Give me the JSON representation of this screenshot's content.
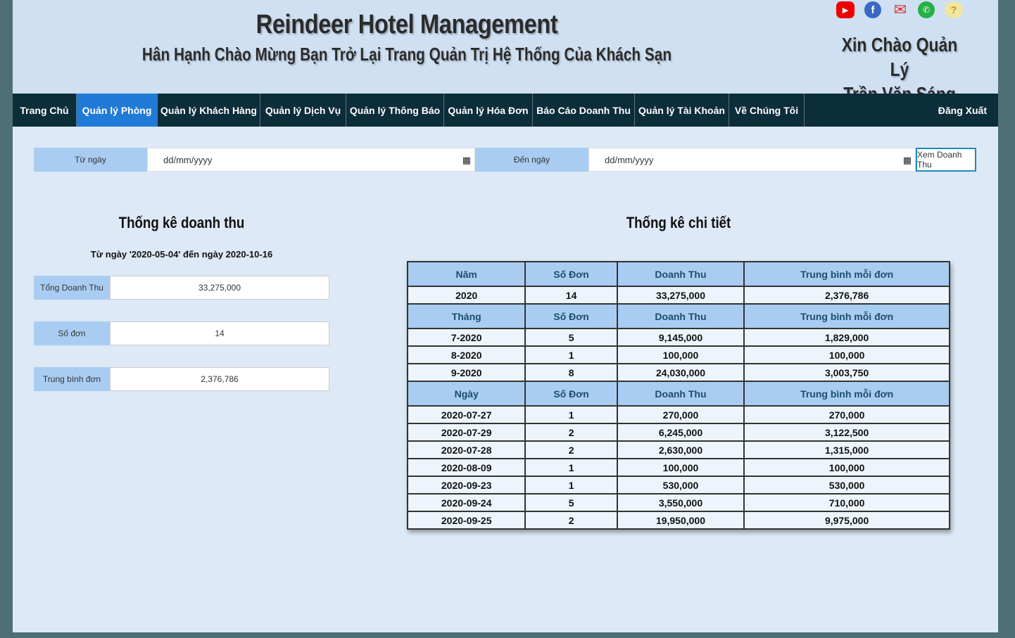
{
  "header": {
    "title": "Reindeer Hotel Management",
    "subtitle": "Hân Hạnh Chào Mừng Bạn Trở Lại Trang Quản Trị Hệ Thống Của Khách Sạn",
    "greeting_line1": "Xin Chào Quản Lý",
    "greeting_line2": "Trần Văn Sáng",
    "social_icons": [
      "youtube-icon",
      "facebook-icon",
      "gmail-icon",
      "whatsapp-icon",
      "help-icon"
    ]
  },
  "nav": {
    "items": [
      {
        "label": "Trang Chủ"
      },
      {
        "label": "Quản lý Phòng",
        "active": true
      },
      {
        "label": "Quản lý Khách Hàng"
      },
      {
        "label": "Quản lý Dịch Vụ"
      },
      {
        "label": "Quản lý Thông Báo"
      },
      {
        "label": "Quản lý Hóa Đơn"
      },
      {
        "label": "Báo Cáo Doanh Thu"
      },
      {
        "label": "Quản lý Tài Khoản"
      },
      {
        "label": "Về Chúng Tôi"
      }
    ],
    "logout": "Đăng Xuất",
    "active_color": "#1f7bd6",
    "bar_color": "#0c2d3a"
  },
  "filter": {
    "from_label": "Từ ngày",
    "from_placeholder": "dd/mm/yyyy",
    "to_label": "Đến ngày",
    "to_placeholder": "dd/mm/yyyy",
    "submit": "Xem Doanh Thu"
  },
  "summary": {
    "title": "Thống kê doanh thu",
    "range": "Từ ngày '2020-05-04' đến ngày 2020-10-16",
    "total_label": "Tổng Doanh Thu",
    "total_value": "33,275,000",
    "orders_label": "Số đơn",
    "orders_value": "14",
    "avg_label": "Trung bình đơn",
    "avg_value": "2,376,786"
  },
  "detail": {
    "title": "Thống kê chi tiết",
    "year_header": [
      "Năm",
      "Số Đơn",
      "Doanh Thu",
      "Trung bình mỗi đơn"
    ],
    "year_rows": [
      [
        "2020",
        "14",
        "33,275,000",
        "2,376,786"
      ]
    ],
    "month_header": [
      "Tháng",
      "Số Đơn",
      "Doanh Thu",
      "Trung bình mỗi đơn"
    ],
    "month_rows": [
      [
        "7-2020",
        "5",
        "9,145,000",
        "1,829,000"
      ],
      [
        "8-2020",
        "1",
        "100,000",
        "100,000"
      ],
      [
        "9-2020",
        "8",
        "24,030,000",
        "3,003,750"
      ]
    ],
    "day_header": [
      "Ngày",
      "Số Đơn",
      "Doanh Thu",
      "Trung bình mỗi đơn"
    ],
    "day_rows": [
      [
        "2020-07-27",
        "1",
        "270,000",
        "270,000"
      ],
      [
        "2020-07-29",
        "2",
        "6,245,000",
        "3,122,500"
      ],
      [
        "2020-07-28",
        "2",
        "2,630,000",
        "1,315,000"
      ],
      [
        "2020-08-09",
        "1",
        "100,000",
        "100,000"
      ],
      [
        "2020-09-23",
        "1",
        "530,000",
        "530,000"
      ],
      [
        "2020-09-24",
        "5",
        "3,550,000",
        "710,000"
      ],
      [
        "2020-09-25",
        "2",
        "19,950,000",
        "9,975,000"
      ]
    ]
  }
}
